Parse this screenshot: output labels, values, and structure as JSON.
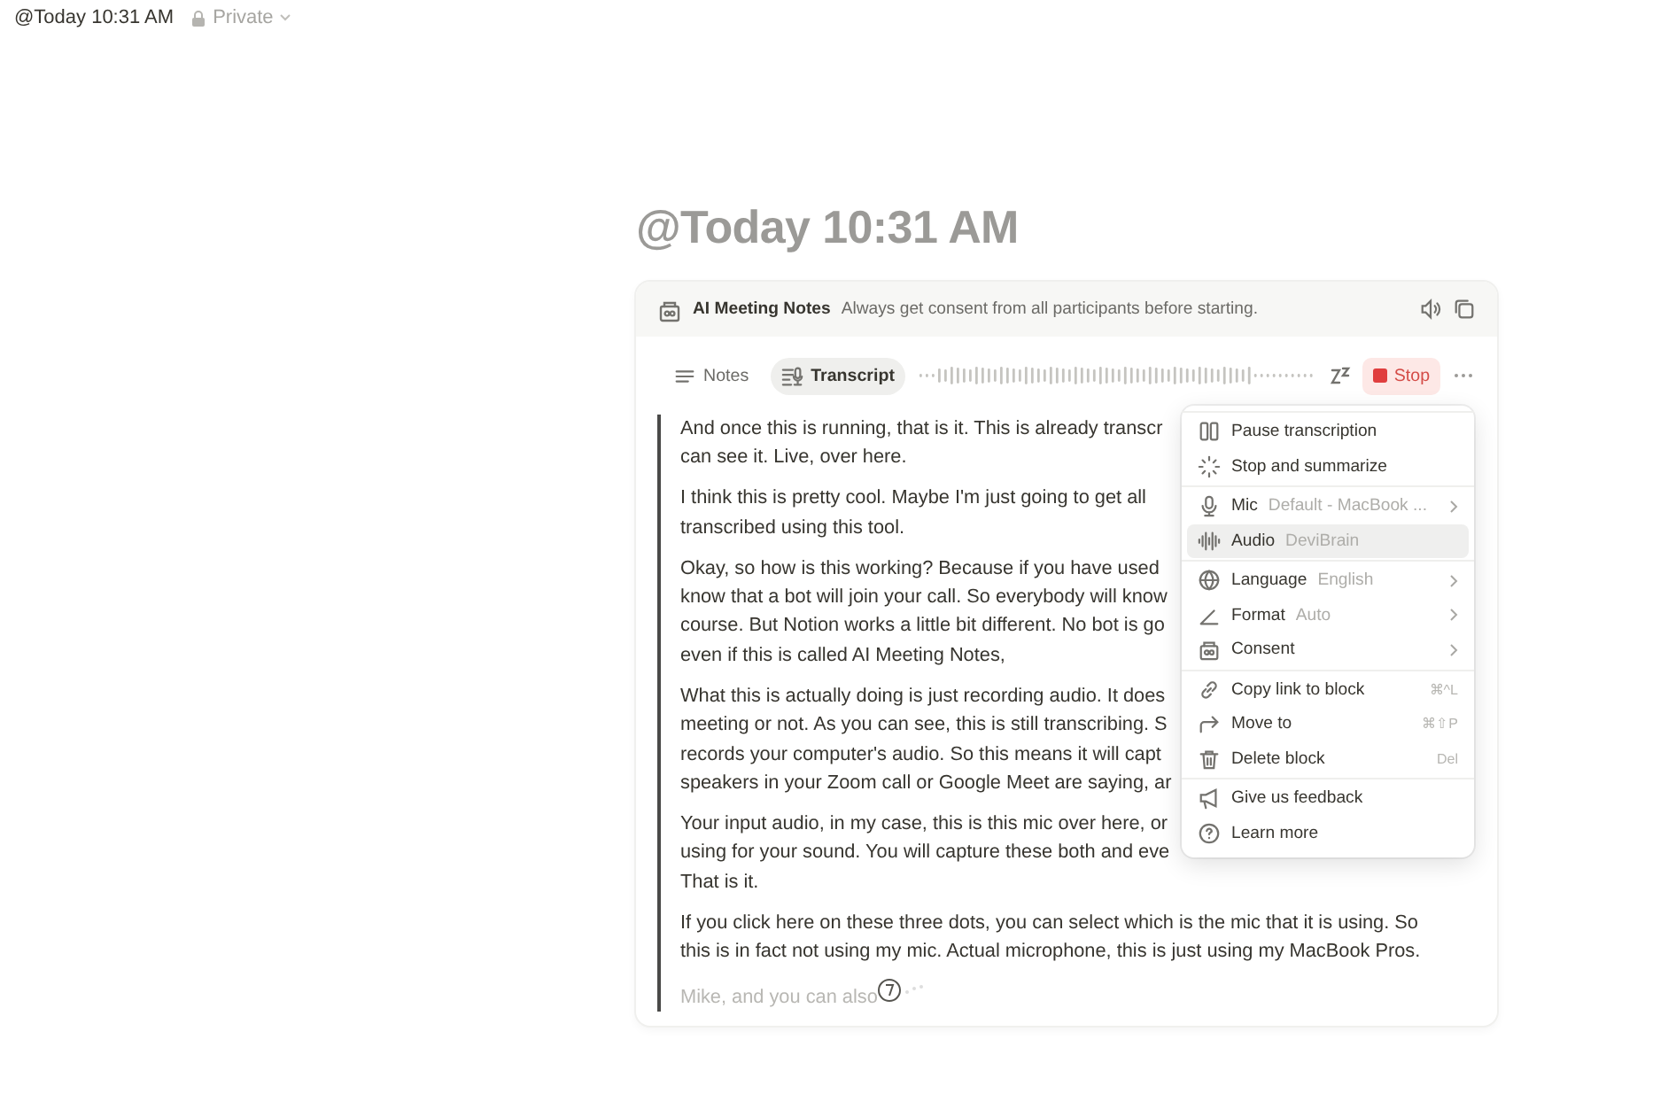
{
  "breadcrumb": {
    "title": "@Today 10:31 AM",
    "privacy": "Private"
  },
  "page_title": "@Today 10:31 AM",
  "block": {
    "name": "AI Meeting Notes",
    "notice": "Always get consent from all participants before starting.",
    "tabs": [
      {
        "label": "Notes",
        "selected": false
      },
      {
        "label": "Transcript",
        "selected": true
      }
    ],
    "stop_label": "Stop",
    "paragraphs": [
      {
        "live": false,
        "lines": [
          "And once this is running, that is it. This is already transcr",
          "can see it. Live, over here."
        ]
      },
      {
        "live": false,
        "lines": [
          "I think this is pretty cool. Maybe I'm just going to get all",
          "transcribed using this tool."
        ]
      },
      {
        "live": false,
        "lines": [
          "Okay, so how is this working? Because if you have used",
          "know that a bot will join your call. So everybody will know",
          "course. But Notion works a little bit different. No bot is go",
          "even if this is called AI Meeting Notes,"
        ]
      },
      {
        "live": false,
        "lines": [
          "What this is actually doing is just recording audio. It does",
          "meeting or not. As you can see, this is still transcribing. S",
          "records your computer's audio. So this means it will capt",
          "speakers in your Zoom call or Google Meet are saying, ar"
        ]
      },
      {
        "live": false,
        "lines": [
          "Your input audio, in my case, this is this mic over here, or",
          "using for your sound. You will capture these both and eve",
          "That is it."
        ]
      },
      {
        "live": false,
        "lines": [
          "If you click here on these three dots, you can select which is the mic that it is using. So",
          "this is in fact not using my mic. Actual microphone, this is just using my MacBook Pros."
        ]
      },
      {
        "live": true,
        "lines": [
          "Mike, and you can also"
        ]
      }
    ]
  },
  "menu": {
    "sections": [
      [
        {
          "label": "Pause transcription",
          "hover": false
        },
        {
          "label": "Stop and summarize",
          "hover": false
        }
      ],
      [
        {
          "label": "Mic",
          "detail": "Default - MacBook ...",
          "submenu": true,
          "hover": false
        },
        {
          "label": "Audio",
          "detail": "DeviBrain",
          "hover": true
        }
      ],
      [
        {
          "label": "Language",
          "detail": "English",
          "submenu": true,
          "hover": false
        },
        {
          "label": "Format",
          "detail": "Auto",
          "submenu": true,
          "hover": false
        },
        {
          "label": "Consent",
          "submenu": true,
          "hover": false
        }
      ],
      [
        {
          "label": "Copy link to block",
          "shortcut": "⌘^L",
          "hover": false
        },
        {
          "label": "Move to",
          "shortcut": "⌘⇧P",
          "hover": false
        },
        {
          "label": "Delete block",
          "shortcut": "Del",
          "hover": false
        }
      ],
      [
        {
          "label": "Give us feedback",
          "hover": false
        },
        {
          "label": "Learn more",
          "hover": false
        }
      ]
    ]
  }
}
